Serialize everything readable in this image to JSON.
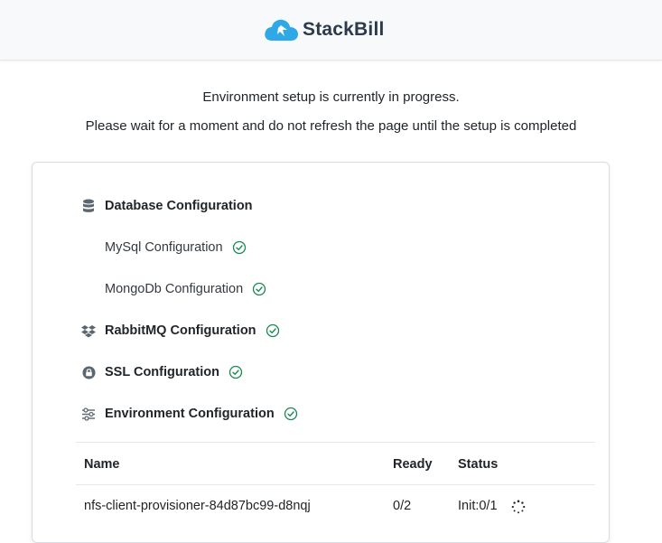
{
  "header": {
    "brand_name": "StackBill"
  },
  "messages": {
    "line1": "Environment setup is currently in progress.",
    "line2": "Please wait for a moment and do not refresh the page until the setup is completed"
  },
  "steps": {
    "database": {
      "label": "Database Configuration",
      "icon": "database-icon",
      "children": [
        {
          "label": "MySql Configuration",
          "status": "completed"
        },
        {
          "label": "MongoDb Configuration",
          "status": "completed"
        }
      ]
    },
    "rabbitmq": {
      "label": "RabbitMQ Configuration",
      "icon": "dropbox-icon",
      "status": "completed"
    },
    "ssl": {
      "label": "SSL Configuration",
      "icon": "lock-icon",
      "status": "completed"
    },
    "environment": {
      "label": "Environment Configuration",
      "icon": "sliders-icon",
      "status": "completed"
    }
  },
  "table": {
    "columns": [
      "Name",
      "Ready",
      "Status"
    ],
    "rows": [
      {
        "name": "nfs-client-provisioner-84d87bc99-d8nqj",
        "ready": "0/2",
        "status": "Init:0/1"
      }
    ]
  },
  "colors": {
    "success": "#198754",
    "brand_blue": "#2ea8e6",
    "icon_gray": "#5c6670"
  }
}
